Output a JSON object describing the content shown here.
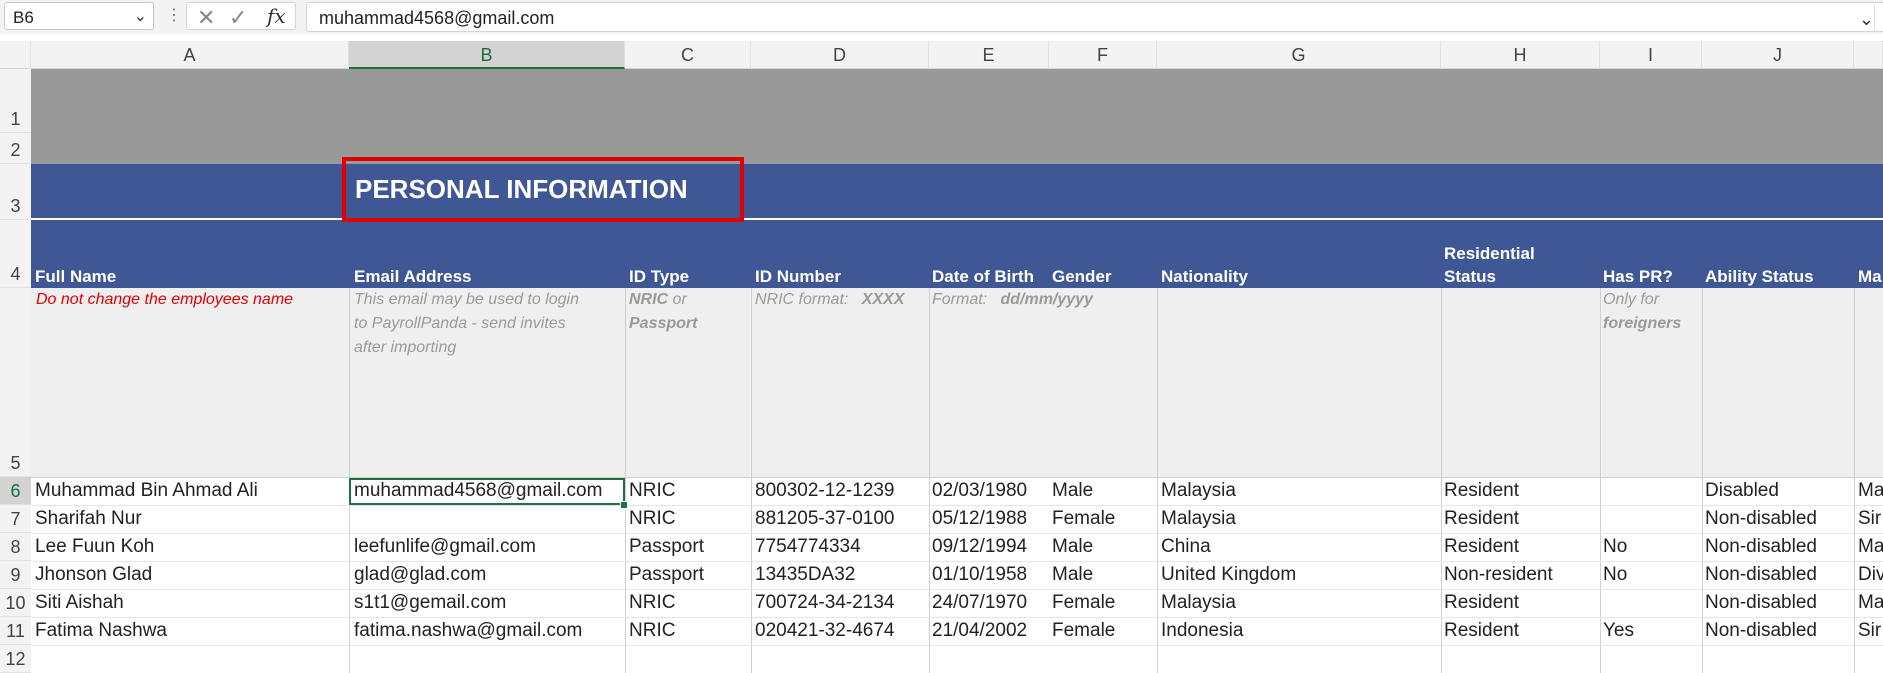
{
  "formula_bar": {
    "name_box": "B6",
    "formula": "muhammad4568@gmail.com",
    "cancel_glyph": "✕",
    "confirm_glyph": "✓",
    "fx_label": "fx"
  },
  "columns": [
    "A",
    "B",
    "C",
    "D",
    "E",
    "F",
    "G",
    "H",
    "I",
    "J"
  ],
  "columns_cut": "",
  "rows": [
    "1",
    "2",
    "3",
    "4",
    "5",
    "6",
    "7",
    "8",
    "9",
    "10",
    "11",
    "12"
  ],
  "section_title": "PERSONAL INFORMATION",
  "headers": {
    "full_name": "Full Name",
    "email": "Email Address",
    "id_type": "ID Type",
    "id_number": "ID Number",
    "dob": "Date of Birth",
    "gender": "Gender",
    "nationality": "Nationality",
    "res_status_1": "Residential",
    "res_status_2": "Status",
    "has_pr": "Has PR?",
    "ability": "Ability Status",
    "next_cut": "Ma"
  },
  "notes": {
    "full_name": "Do not change the employees name",
    "email_1": "This email may be used to login",
    "email_2": "to PayrollPanda - send invites",
    "email_3": "after importing",
    "id_type_1a": "NRIC",
    "id_type_1b": " or",
    "id_type_2": "Passport",
    "id_number_a": "NRIC format:",
    "id_number_b": "XXXX",
    "dob_a": "Format:",
    "dob_b": "dd/mm/yyyy",
    "has_pr_1": "Only for",
    "has_pr_2": "foreigners"
  },
  "table": {
    "rows": [
      {
        "name": "Muhammad Bin Ahmad Ali",
        "email": "muhammad4568@gmail.com",
        "id_type": "NRIC",
        "id_number": "800302-12-1239",
        "dob": "02/03/1980",
        "gender": "Male",
        "nationality": "Malaysia",
        "res": "Resident",
        "pr": "",
        "ability": "Disabled",
        "next": "Ma"
      },
      {
        "name": "Sharifah Nur",
        "email": "",
        "id_type": "NRIC",
        "id_number": "881205-37-0100",
        "dob": "05/12/1988",
        "gender": "Female",
        "nationality": "Malaysia",
        "res": "Resident",
        "pr": "",
        "ability": "Non-disabled",
        "next": "Sir"
      },
      {
        "name": "Lee Fuun Koh",
        "email": "leefunlife@gmail.com",
        "id_type": "Passport",
        "id_number": "7754774334",
        "dob": "09/12/1994",
        "gender": "Male",
        "nationality": "China",
        "res": "Resident",
        "pr": "No",
        "ability": "Non-disabled",
        "next": "Ma"
      },
      {
        "name": "Jhonson Glad",
        "email": "glad@glad.com",
        "id_type": "Passport",
        "id_number": "13435DA32",
        "dob": "01/10/1958",
        "gender": "Male",
        "nationality": "United Kingdom",
        "res": "Non-resident",
        "pr": "No",
        "ability": "Non-disabled",
        "next": "Div"
      },
      {
        "name": "Siti Aishah",
        "email": "s1t1@gemail.com",
        "id_type": "NRIC",
        "id_number": "700724-34-2134",
        "dob": "24/07/1970",
        "gender": "Female",
        "nationality": "Malaysia",
        "res": "Resident",
        "pr": "",
        "ability": "Non-disabled",
        "next": "Ma"
      },
      {
        "name": "Fatima Nashwa",
        "email": "fatima.nashwa@gmail.com",
        "id_type": "NRIC",
        "id_number": "020421-32-4674",
        "dob": "21/04/2002",
        "gender": "Female",
        "nationality": "Indonesia",
        "res": "Resident",
        "pr": "Yes",
        "ability": "Non-disabled",
        "next": "Sir"
      }
    ]
  },
  "colors": {
    "header_blue": "#3f5895",
    "top_gray": "#999999",
    "note_gray": "#efefef",
    "highlight_red": "#e00000",
    "selection_green": "#1e7145"
  }
}
